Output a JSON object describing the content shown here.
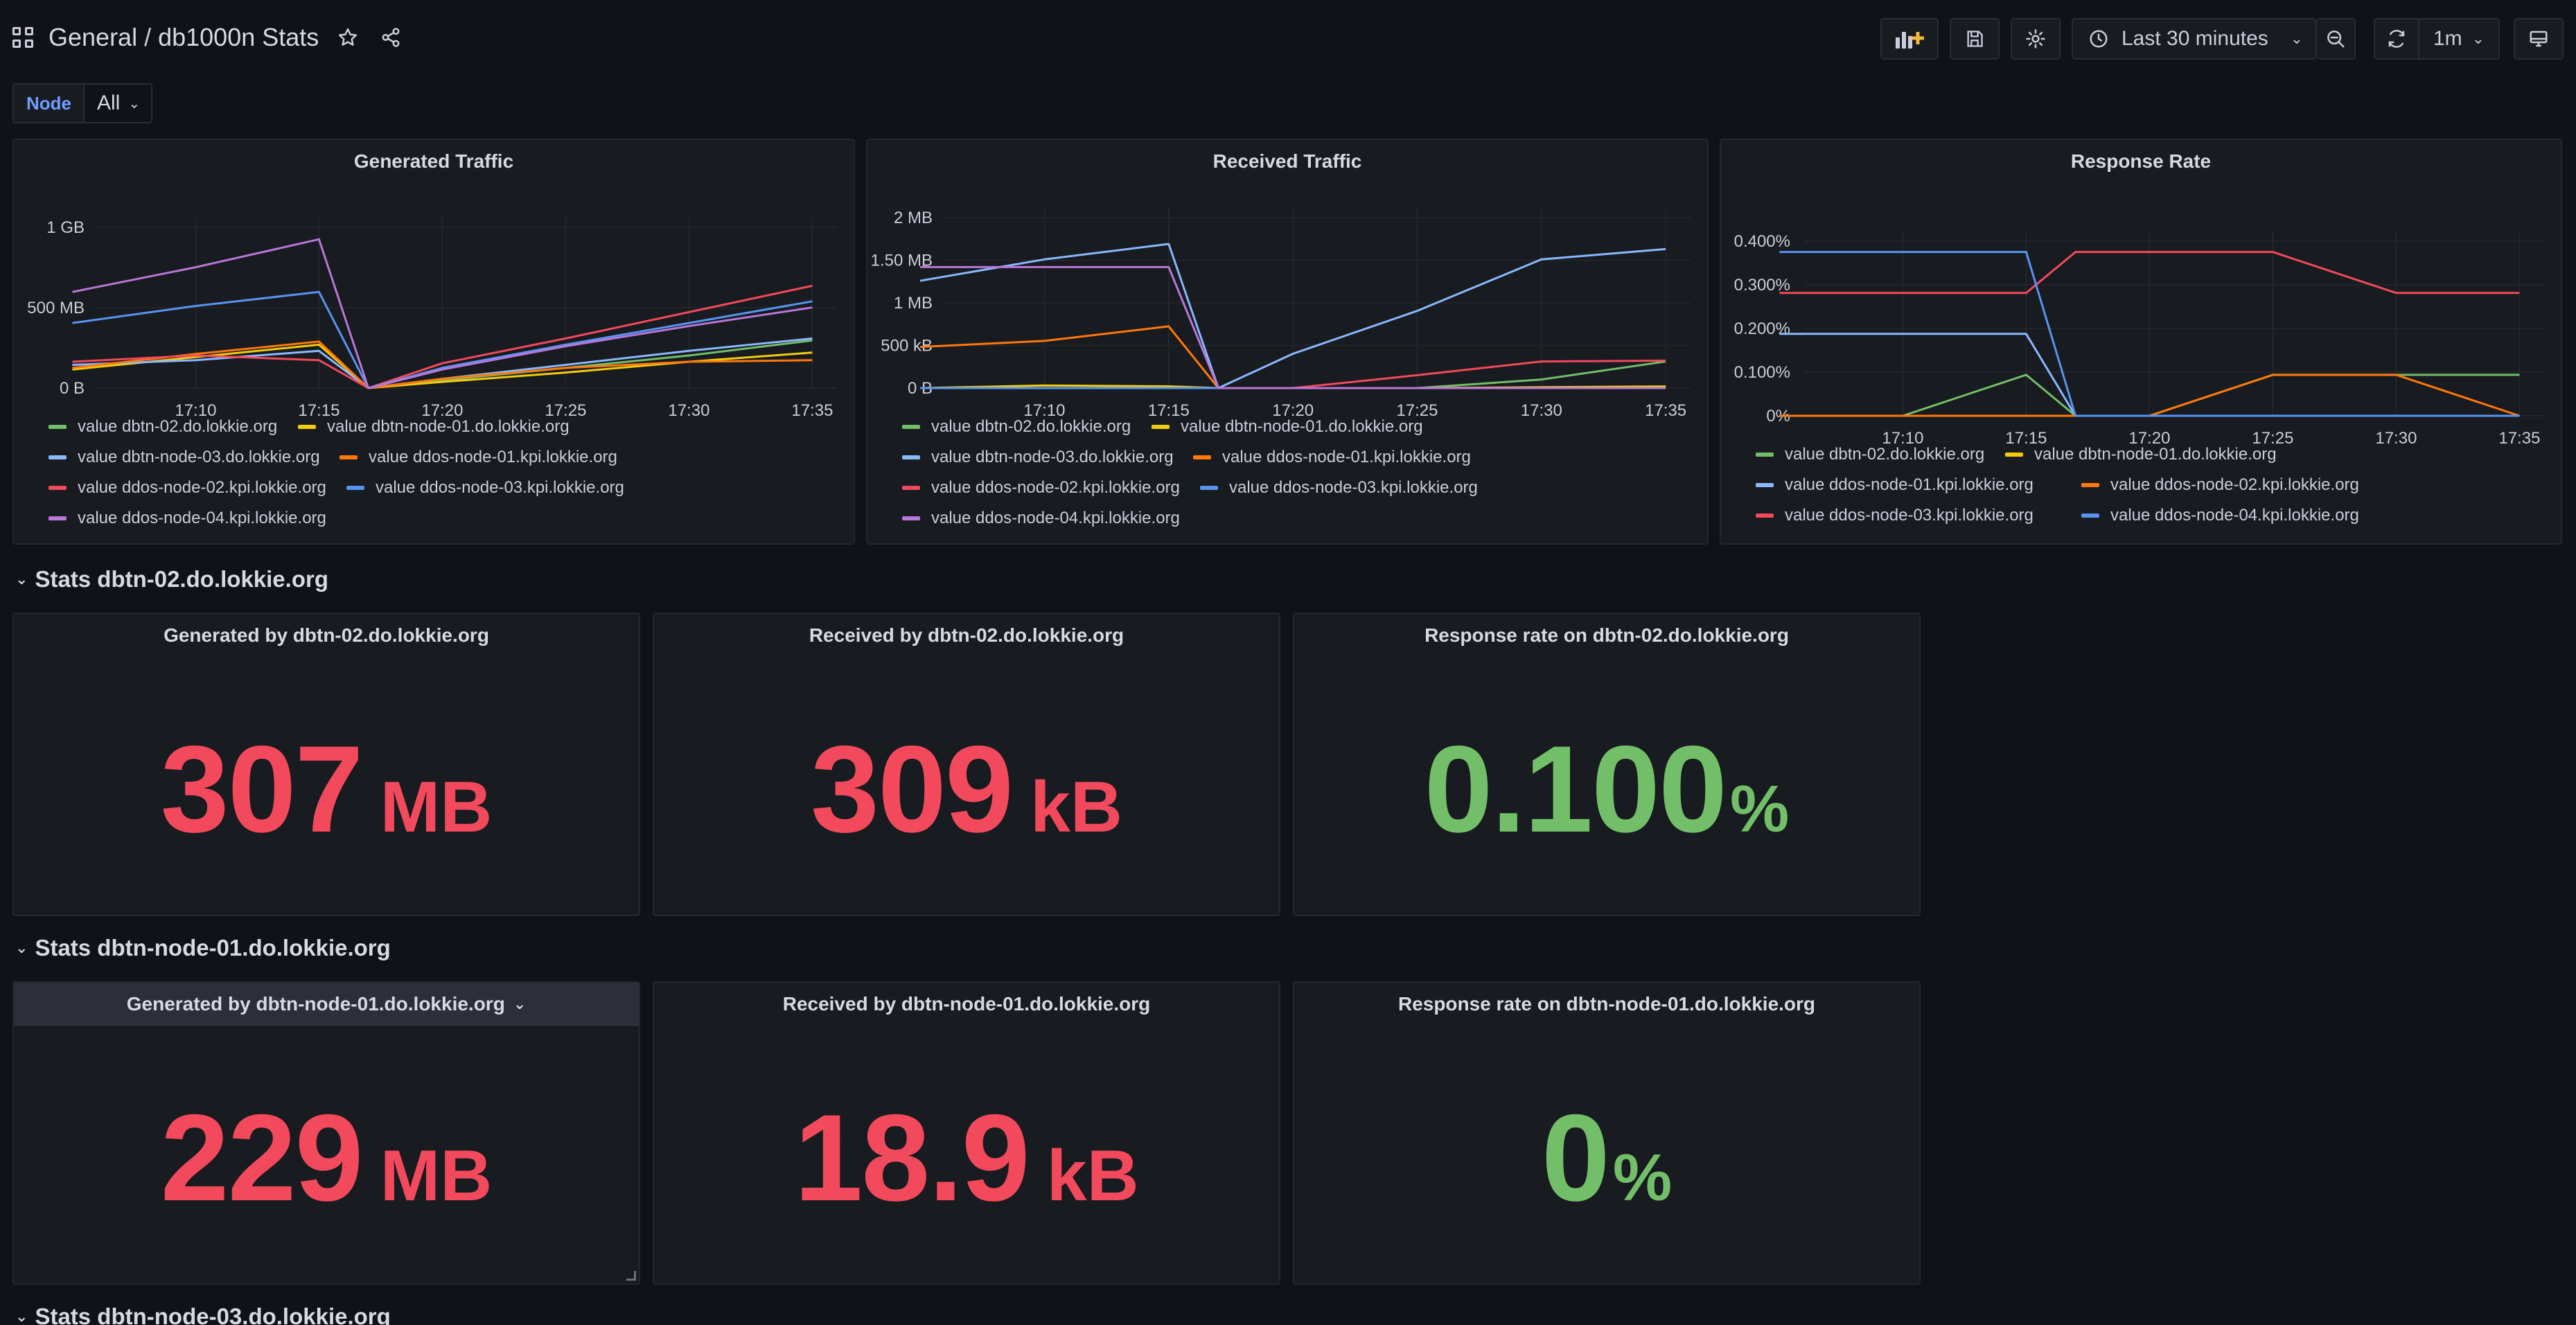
{
  "header": {
    "folder": "General",
    "separator": "/",
    "dashboard": "db1000n Stats",
    "time_range": "Last 30 minutes",
    "refresh_interval": "1m",
    "icons": [
      "apps-icon",
      "star-icon",
      "share-icon",
      "add-panel-icon",
      "save-icon",
      "settings-icon",
      "clock-icon",
      "zoom-out-icon",
      "refresh-icon",
      "tv-icon"
    ]
  },
  "variables": {
    "label": "Node",
    "value": "All"
  },
  "colors": {
    "green": "#73bf69",
    "yellow": "#f2cc0c",
    "blue": "#8ab8ff",
    "orange": "#ff780a",
    "red": "#f2495c",
    "blue2": "#5794f2",
    "purple": "#b877d9",
    "stat_red": "#f2495c",
    "stat_green": "#73bf69"
  },
  "x_ticks": [
    "17:10",
    "17:15",
    "17:20",
    "17:25",
    "17:30",
    "17:35"
  ],
  "panels": {
    "generated": {
      "title": "Generated Traffic",
      "y_ticks": [
        "1 GB",
        "500 MB",
        "0 B"
      ],
      "legend": [
        {
          "label": "value dbtn-02.do.lokkie.org",
          "color": "#73bf69"
        },
        {
          "label": "value dbtn-node-01.do.lokkie.org",
          "color": "#f2cc0c"
        },
        {
          "label": "value dbtn-node-03.do.lokkie.org",
          "color": "#8ab8ff"
        },
        {
          "label": "value ddos-node-01.kpi.lokkie.org",
          "color": "#ff780a"
        },
        {
          "label": "value ddos-node-02.kpi.lokkie.org",
          "color": "#f2495c"
        },
        {
          "label": "value ddos-node-03.kpi.lokkie.org",
          "color": "#5794f2"
        },
        {
          "label": "value ddos-node-04.kpi.lokkie.org",
          "color": "#b877d9"
        }
      ]
    },
    "received": {
      "title": "Received Traffic",
      "y_ticks": [
        "2 MB",
        "1.50 MB",
        "1 MB",
        "500 kB",
        "0 B"
      ],
      "legend": [
        {
          "label": "value dbtn-02.do.lokkie.org",
          "color": "#73bf69"
        },
        {
          "label": "value dbtn-node-01.do.lokkie.org",
          "color": "#f2cc0c"
        },
        {
          "label": "value dbtn-node-03.do.lokkie.org",
          "color": "#8ab8ff"
        },
        {
          "label": "value ddos-node-01.kpi.lokkie.org",
          "color": "#ff780a"
        },
        {
          "label": "value ddos-node-02.kpi.lokkie.org",
          "color": "#f2495c"
        },
        {
          "label": "value ddos-node-03.kpi.lokkie.org",
          "color": "#5794f2"
        },
        {
          "label": "value ddos-node-04.kpi.lokkie.org",
          "color": "#b877d9"
        }
      ]
    },
    "response": {
      "title": "Response Rate",
      "y_ticks": [
        "0.400%",
        "0.300%",
        "0.200%",
        "0.100%",
        "0%"
      ],
      "legend": [
        {
          "label": "value dbtn-02.do.lokkie.org",
          "color": "#73bf69"
        },
        {
          "label": "value dbtn-node-01.do.lokkie.org",
          "color": "#f2cc0c"
        },
        {
          "label": "value ddos-node-01.kpi.lokkie.org",
          "color": "#8ab8ff"
        },
        {
          "label": "value ddos-node-02.kpi.lokkie.org",
          "color": "#ff780a"
        },
        {
          "label": "value ddos-node-03.kpi.lokkie.org",
          "color": "#f2495c"
        },
        {
          "label": "value ddos-node-04.kpi.lokkie.org",
          "color": "#5794f2"
        }
      ]
    }
  },
  "chart_data": [
    {
      "type": "line",
      "title": "Generated Traffic",
      "x_unit": "time",
      "x": [
        "17:05",
        "17:10",
        "17:15",
        "17:17",
        "17:20",
        "17:25",
        "17:30",
        "17:35"
      ],
      "ylim": [
        0,
        1100
      ],
      "y_unit": "MB",
      "series": [
        {
          "name": "value dbtn-02.do.lokkie.org",
          "values": [
            null,
            null,
            null,
            0,
            50,
            130,
            210,
            307
          ]
        },
        {
          "name": "value dbtn-node-01.do.lokkie.org",
          "values": [
            120,
            200,
            280,
            0,
            40,
            100,
            170,
            229
          ]
        },
        {
          "name": "value dbtn-node-03.do.lokkie.org",
          "values": [
            150,
            180,
            240,
            0,
            60,
            150,
            240,
            320
          ]
        },
        {
          "name": "value ddos-node-01.kpi.lokkie.org",
          "values": [
            130,
            220,
            300,
            0,
            60,
            130,
            170,
            180
          ]
        },
        {
          "name": "value ddos-node-02.kpi.lokkie.org",
          "values": [
            170,
            210,
            180,
            0,
            160,
            320,
            490,
            660
          ]
        },
        {
          "name": "value ddos-node-03.kpi.lokkie.org",
          "values": [
            420,
            530,
            620,
            0,
            130,
            280,
            420,
            560
          ]
        },
        {
          "name": "value ddos-node-04.kpi.lokkie.org",
          "values": [
            620,
            780,
            960,
            0,
            120,
            270,
            400,
            520
          ]
        }
      ]
    },
    {
      "type": "line",
      "title": "Received Traffic",
      "x_unit": "time",
      "x": [
        "17:05",
        "17:10",
        "17:15",
        "17:17",
        "17:20",
        "17:25",
        "17:30",
        "17:35"
      ],
      "ylim": [
        0,
        2100
      ],
      "y_unit": "kB",
      "series": [
        {
          "name": "value dbtn-02.do.lokkie.org",
          "values": [
            0,
            0,
            0,
            0,
            0,
            0,
            100,
            309
          ]
        },
        {
          "name": "value dbtn-node-01.do.lokkie.org",
          "values": [
            0,
            30,
            20,
            0,
            0,
            0,
            10,
            19
          ]
        },
        {
          "name": "value dbtn-node-03.do.lokkie.org",
          "values": [
            1250,
            1500,
            1680,
            0,
            400,
            900,
            1500,
            1620
          ]
        },
        {
          "name": "value ddos-node-01.kpi.lokkie.org",
          "values": [
            480,
            550,
            720,
            0,
            0,
            0,
            0,
            0
          ]
        },
        {
          "name": "value ddos-node-02.kpi.lokkie.org",
          "values": [
            0,
            0,
            0,
            0,
            0,
            150,
            310,
            320
          ]
        },
        {
          "name": "value ddos-node-03.kpi.lokkie.org",
          "values": [
            0,
            0,
            0,
            0,
            0,
            0,
            0,
            0
          ]
        },
        {
          "name": "value ddos-node-04.kpi.lokkie.org",
          "values": [
            1410,
            1410,
            1410,
            0,
            0,
            0,
            0,
            0
          ]
        }
      ]
    },
    {
      "type": "line",
      "title": "Response Rate",
      "x_unit": "time",
      "x": [
        "17:05",
        "17:10",
        "17:15",
        "17:17",
        "17:20",
        "17:25",
        "17:30",
        "17:35"
      ],
      "ylim": [
        0,
        0.45
      ],
      "y_unit": "%",
      "series": [
        {
          "name": "value dbtn-02.do.lokkie.org",
          "values": [
            0,
            0,
            0.1,
            0,
            0,
            0.1,
            0.1,
            0.1
          ]
        },
        {
          "name": "value dbtn-node-01.do.lokkie.org",
          "values": [
            0,
            0,
            0,
            0,
            0,
            0,
            0,
            0
          ]
        },
        {
          "name": "value ddos-node-01.kpi.lokkie.org",
          "values": [
            0.2,
            0.2,
            0.2,
            0,
            0,
            0,
            0,
            0
          ]
        },
        {
          "name": "value ddos-node-02.kpi.lokkie.org",
          "values": [
            0,
            0,
            0,
            0,
            0,
            0.1,
            0.1,
            0
          ]
        },
        {
          "name": "value ddos-node-03.kpi.lokkie.org",
          "values": [
            0.3,
            0.3,
            0.3,
            0.4,
            0.4,
            0.4,
            0.3,
            0.3
          ]
        },
        {
          "name": "value ddos-node-04.kpi.lokkie.org",
          "values": [
            0.4,
            0.4,
            0.4,
            0,
            0,
            0,
            0,
            0
          ]
        }
      ]
    }
  ],
  "rows": [
    {
      "title": "Stats dbtn-02.do.lokkie.org",
      "stats": [
        {
          "title": "Generated by dbtn-02.do.lokkie.org",
          "value": "307",
          "unit": "MB",
          "color": "#f2495c"
        },
        {
          "title": "Received by dbtn-02.do.lokkie.org",
          "value": "309",
          "unit": "kB",
          "color": "#f2495c"
        },
        {
          "title": "Response rate on dbtn-02.do.lokkie.org",
          "value": "0.100",
          "unit": "%",
          "color": "#73bf69"
        }
      ]
    },
    {
      "title": "Stats dbtn-node-01.do.lokkie.org",
      "stats": [
        {
          "title": "Generated by dbtn-node-01.do.lokkie.org",
          "value": "229",
          "unit": "MB",
          "color": "#f2495c"
        },
        {
          "title": "Received by dbtn-node-01.do.lokkie.org",
          "value": "18.9",
          "unit": "kB",
          "color": "#f2495c"
        },
        {
          "title": "Response rate on dbtn-node-01.do.lokkie.org",
          "value": "0",
          "unit": "%",
          "color": "#73bf69"
        }
      ]
    },
    {
      "title": "Stats dbtn-node-03.do.lokkie.org",
      "stats": []
    }
  ]
}
